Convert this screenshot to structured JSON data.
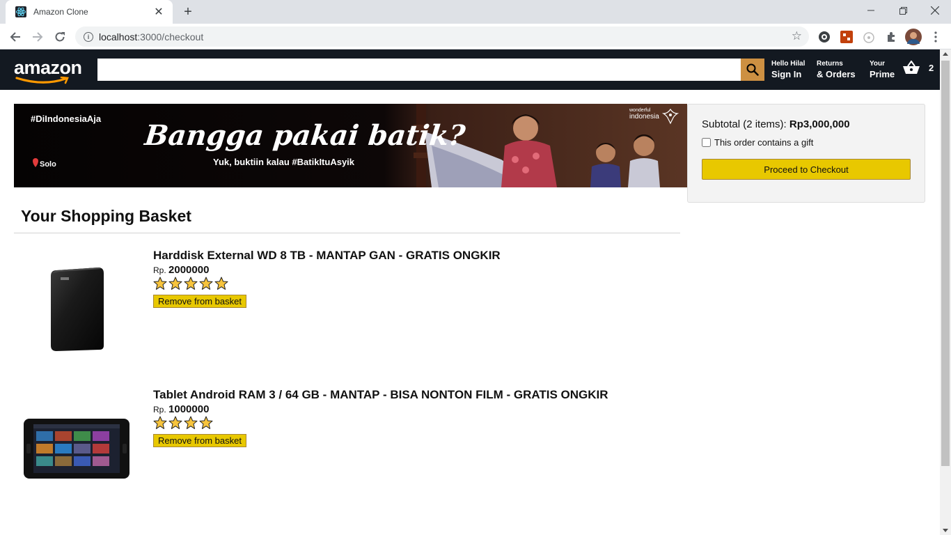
{
  "browser": {
    "tab_title": "Amazon Clone",
    "url_host": "localhost",
    "url_path": ":3000/checkout"
  },
  "header": {
    "logo_text": "amazon",
    "search_placeholder": "",
    "nav": [
      {
        "line1": "Hello Hilal",
        "line2": "Sign In"
      },
      {
        "line1": "Returns",
        "line2": "& Orders"
      },
      {
        "line1": "Your",
        "line2": "Prime"
      }
    ],
    "basket_count": "2"
  },
  "banner": {
    "hashtag": "#DiIndonesiaAja",
    "headline": "Bangga pakai batik?",
    "subline": "Yuk, buktiin kalau #BatikItuAsyik",
    "location": "Solo",
    "brand_small": "wonderful",
    "brand": "indonesia"
  },
  "subtotal": {
    "label": "Subtotal (2 items):",
    "amount": "Rp3,000,000",
    "gift_label": "This order contains a gift",
    "button_label": "Proceed to Checkout"
  },
  "checkout_title": "Your Shopping Basket",
  "products": [
    {
      "title": "Harddisk External WD 8 TB - MANTAP GAN - GRATIS ONGKIR",
      "currency": "Rp.",
      "price": "2000000",
      "rating": 5,
      "remove_label": "Remove from basket"
    },
    {
      "title": "Tablet Android RAM 3 / 64 GB - MANTAP - BISA NONTON FILM - GRATIS ONGKIR",
      "currency": "Rp.",
      "price": "1000000",
      "rating": 4,
      "remove_label": "Remove from basket"
    }
  ],
  "colors": {
    "header_bg": "#131921",
    "search_button": "#cd9042",
    "button_yellow": "#e8c800",
    "star_fill": "#f7c43d"
  }
}
